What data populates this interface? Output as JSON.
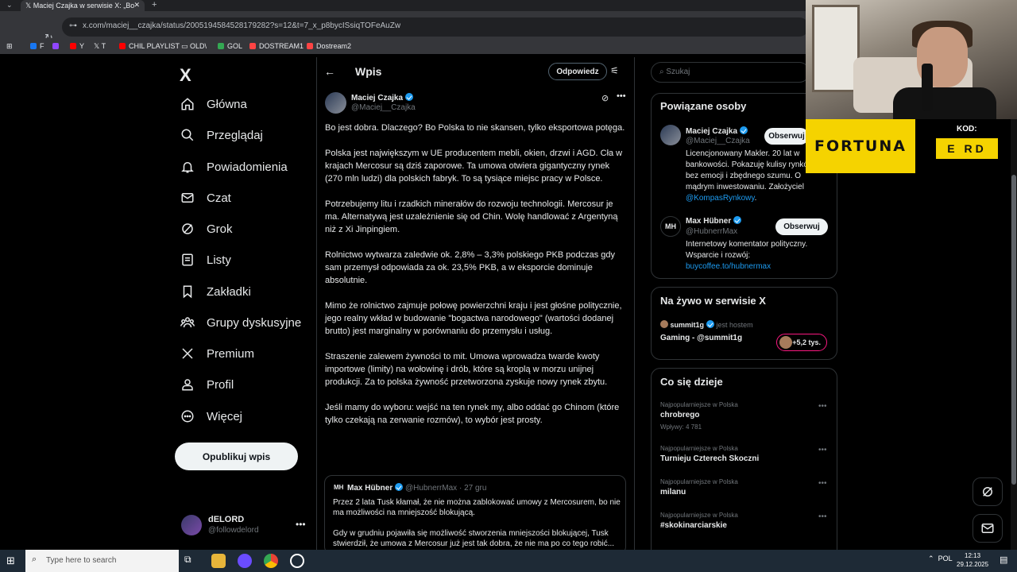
{
  "browser": {
    "tab_title": "Maciej Czajka w serwisie X: „Bo",
    "tab_close": "✕",
    "new_tab": "+",
    "url": "x.com/maciej__czajka/status/2005194584528179282?s=12&t=7_x_p8bycISsiqTOFeAuZw",
    "bookmarks": [
      {
        "label": "F",
        "color": "#1877f2"
      },
      {
        "label": "",
        "color": "#9146ff"
      },
      {
        "label": "Y",
        "color": "#ff0000"
      },
      {
        "label": "T",
        "color": "#ffffff"
      },
      {
        "label": "CHIL PLAYLIST",
        "color": "#ff0000"
      },
      {
        "label": "OLD\\",
        "color": "#e8eaed"
      },
      {
        "label": "GOL",
        "color": "#34a853"
      },
      {
        "label": "DOSTREAM1",
        "color": "#ff4444"
      },
      {
        "label": "Dostream2",
        "color": "#ff4444"
      }
    ]
  },
  "nav": {
    "logo": "X",
    "items": [
      {
        "label": "Główna"
      },
      {
        "label": "Przeglądaj"
      },
      {
        "label": "Powiadomienia"
      },
      {
        "label": "Czat"
      },
      {
        "label": "Grok"
      },
      {
        "label": "Listy"
      },
      {
        "label": "Zakładki"
      },
      {
        "label": "Grupy dyskusyjne"
      },
      {
        "label": "Premium"
      },
      {
        "label": "Profil"
      },
      {
        "label": "Więcej"
      }
    ],
    "post_button": "Opublikuj wpis",
    "account": {
      "name": "dELORD",
      "handle": "@followdelord",
      "more": "•••"
    }
  },
  "post": {
    "header_title": "Wpis",
    "back": "←",
    "reply_button": "Odpowiedz",
    "author_name": "Maciej Czajka",
    "author_handle": "@Maciej__Czajka",
    "more": "•••",
    "paragraphs": [
      "Bo jest dobra. Dlaczego? Bo Polska to nie skansen, tylko eksportowa potęga.",
      "Polska jest największym w UE producentem mebli, okien, drzwi i AGD. Cła w krajach Mercosur są dziś zaporowe. Ta umowa otwiera gigantyczny rynek (270 mln ludzi) dla polskich fabryk. To są tysiące miejsc pracy w Polsce.",
      "Potrzebujemy litu i rzadkich minerałów do rozwoju technologii. Mercosur je ma. Alternatywą jest uzależnienie się od Chin. Wolę handlować z Argentyną niż z Xi Jinpingiem.",
      "Rolnictwo wytwarza zaledwie ok. 2,8% – 3,3% polskiego PKB podczas gdy sam przemysł odpowiada za ok. 23,5% PKB, a w eksporcie dominuje absolutnie.",
      "Mimo że rolnictwo zajmuje połowę powierzchni kraju i jest głośne politycznie, jego realny wkład w budowanie \"bogactwa narodowego\" (wartości dodanej brutto) jest marginalny w porównaniu do przemysłu i usług.",
      "Straszenie zalewem żywności to mit. Umowa wprowadza twarde kwoty importowe (limity) na wołowinę i drób, które są kroplą w morzu unijnej produkcji. Za to polska żywność przetworzona zyskuje nowy rynek zbytu.",
      "Jeśli mamy do wyboru: wejść na ten rynek my, albo oddać go Chinom (które tylko czekają na zerwanie rozmów), to wybór jest prosty."
    ],
    "quote": {
      "avatar_text": "MH",
      "name": "Max Hübner",
      "handle": "@HubnerrMax · 27 gru",
      "paragraphs": [
        "Przez 2 lata Tusk kłamał, że nie można zablokować umowy z Mercosurem, bo nie ma możliwości na mniejszość blokującą.",
        "Gdy w grudniu pojawiła się możliwość stworzenia mniejszości blokującej, Tusk stwierdził, że umowa z Mercosur już jest tak dobra, że nie ma po co tego robić..."
      ]
    }
  },
  "sidebar": {
    "search_placeholder": "Szukaj",
    "related_title": "Powiązane osoby",
    "people": [
      {
        "name": "Maciej Czajka",
        "handle": "@Maciej__Czajka",
        "follow": "Obserwuj",
        "bio": "Licencjonowany Makler. 20 lat w bankowości. Pokazuję kulisy rynków bez emocji i zbędnego szumu. O mądrym inwestowaniu. Założyciel",
        "link": "@KompasRynkowy",
        "bio_end": "."
      },
      {
        "name": "Max Hübner",
        "avatar_text": "MH",
        "handle": "@HubnerrMax",
        "follow": "Obserwuj",
        "bio": "Internetowy komentator polityczny. Wsparcie i rozwój:",
        "link": "buycoffee.to/hubnermax"
      }
    ],
    "live_title": "Na żywo w serwisie X",
    "live": {
      "host": "summit1g",
      "host_suffix": "jest hostem",
      "title": "Gaming - @summit1g",
      "count": "+5,2 tys."
    },
    "trends_title": "Co się dzieje",
    "trends": [
      {
        "category": "Najpopularniejsze w Polska",
        "name": "chrobrego",
        "count": "Wpływy: 4 781"
      },
      {
        "category": "Najpopularniejsze w Polska",
        "name": "Turnieju Czterech Skoczni",
        "count": ""
      },
      {
        "category": "Najpopularniejsze w Polska",
        "name": "milanu",
        "count": ""
      },
      {
        "category": "Najpopularniejsze w Polska",
        "name": "#skokinarciarskie",
        "count": ""
      }
    ],
    "trend_more": "•••"
  },
  "overlay": {
    "sponsor": "FORTUNA",
    "kod_label": "KOD:",
    "kod_value": "E RD"
  },
  "taskbar": {
    "search_placeholder": "Type here to search",
    "lang": "POL",
    "time": "12:13",
    "date": "29.12.2025"
  },
  "colors": {
    "accent": "#1d9bf0",
    "sponsor_yellow": "#f5d300",
    "border": "#2f3336"
  }
}
